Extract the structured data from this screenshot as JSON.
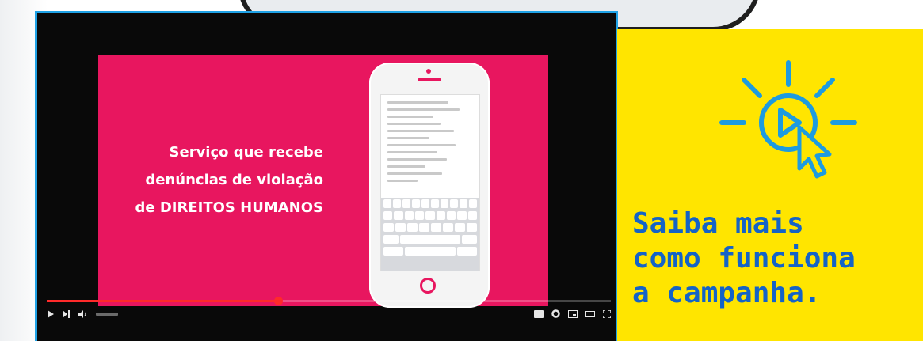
{
  "video": {
    "slide_lines": [
      "Serviço que recebe",
      "denúncias de violação",
      "de DIREITOS HUMANOS"
    ],
    "progress_fraction": 0.41,
    "brand_color": "#e8165f",
    "controls": {
      "left": [
        "play-icon",
        "next-icon",
        "volume-icon"
      ],
      "right": [
        "subtitles-icon",
        "settings-icon",
        "miniplayer-icon",
        "theater-icon",
        "fullscreen-icon"
      ]
    }
  },
  "cta": {
    "lines": [
      "Saiba mais",
      "como funciona",
      "a campanha."
    ],
    "icon": "play-click-icon",
    "background_color": "#ffe500",
    "text_color": "#1463c7"
  }
}
